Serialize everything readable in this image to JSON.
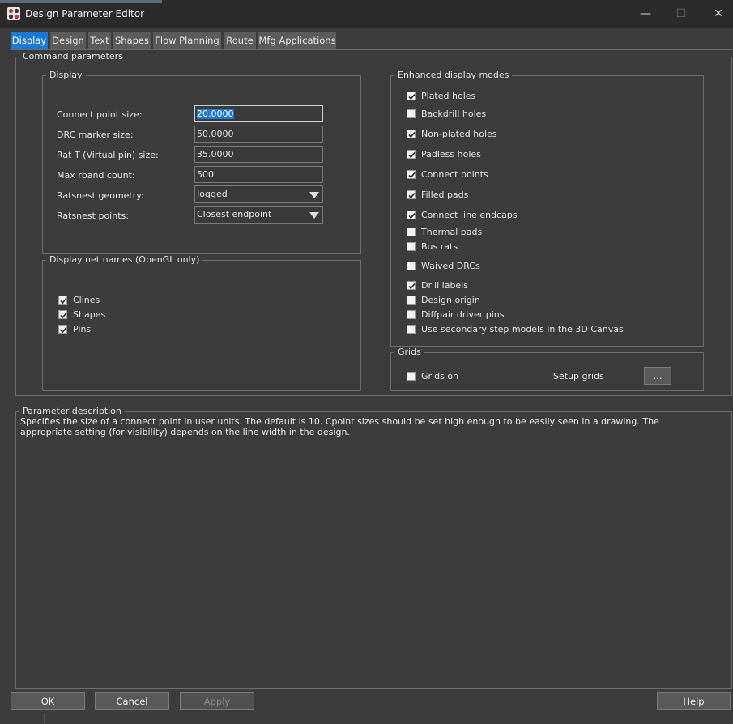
{
  "window": {
    "title": "Design Parameter Editor",
    "minimize": "—",
    "maximize": "☐",
    "close": "✕"
  },
  "tabs": [
    "Display",
    "Design",
    "Text",
    "Shapes",
    "Flow Planning",
    "Route",
    "Mfg Applications"
  ],
  "command_parameters": {
    "label": "Command parameters"
  },
  "display": {
    "label": "Display",
    "fields": [
      {
        "label": "Connect point size:",
        "value": "20.0000"
      },
      {
        "label": "DRC marker size:",
        "value": "50.0000"
      },
      {
        "label": "Rat T (Virtual pin) size:",
        "value": "35.0000"
      },
      {
        "label": "Max rband count:",
        "value": "500"
      }
    ],
    "ratsnest_geometry": {
      "label": "Ratsnest geometry:",
      "value": "Jogged"
    },
    "ratsnest_points": {
      "label": "Ratsnest points:",
      "value": "Closest endpoint"
    }
  },
  "net_names": {
    "label": "Display net names (OpenGL only)",
    "items": [
      {
        "label": "Clines",
        "checked": true
      },
      {
        "label": "Shapes",
        "checked": true
      },
      {
        "label": "Pins",
        "checked": true
      }
    ]
  },
  "enhanced": {
    "label": "Enhanced display modes",
    "items": [
      {
        "label": "Plated holes",
        "checked": true
      },
      {
        "label": "Backdrill holes",
        "checked": false
      },
      {
        "label": "Non-plated holes",
        "checked": true
      },
      {
        "label": "Padless holes",
        "checked": true
      },
      {
        "label": "Connect points",
        "checked": true
      },
      {
        "label": "Filled pads",
        "checked": true
      },
      {
        "label": "Connect line endcaps",
        "checked": true
      },
      {
        "label": "Thermal pads",
        "checked": false
      },
      {
        "label": "Bus rats",
        "checked": false
      },
      {
        "label": "Waived DRCs",
        "checked": false
      },
      {
        "label": "Drill labels",
        "checked": true
      },
      {
        "label": "Design origin",
        "checked": false
      },
      {
        "label": "Diffpair driver pins",
        "checked": false
      },
      {
        "label": "Use secondary step models in the 3D Canvas",
        "checked": false
      }
    ]
  },
  "grids": {
    "label": "Grids",
    "grids_on": "Grids on",
    "setup_grids": "Setup grids",
    "setup_button": "..."
  },
  "description": {
    "label": "Parameter description",
    "text": "Specifies the size of a connect point in user units. The default is 10. Cpoint sizes should be set high enough to be easily seen in a drawing. The appropriate setting (for visibility) depends on the line width in the design."
  },
  "buttons": {
    "ok": "OK",
    "cancel": "Cancel",
    "apply": "Apply",
    "help": "Help"
  }
}
